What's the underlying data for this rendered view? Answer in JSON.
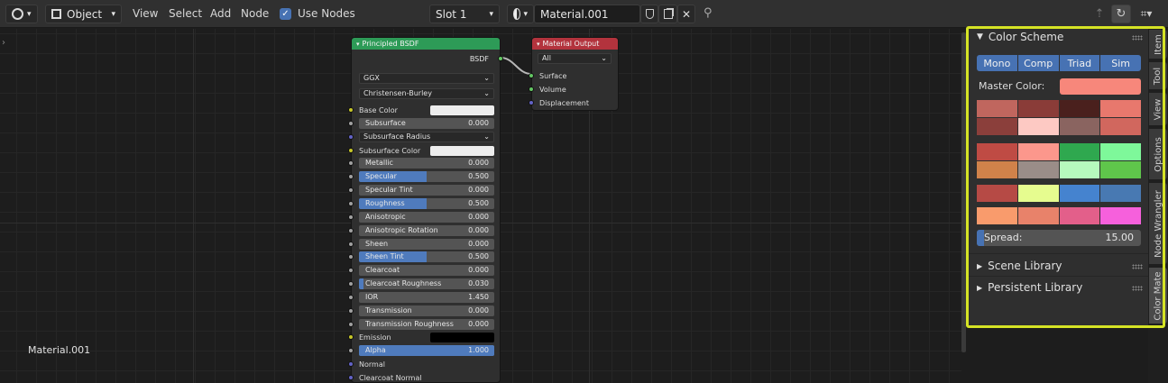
{
  "header": {
    "mode": "Object",
    "menus": [
      "View",
      "Select",
      "Add",
      "Node"
    ],
    "use_nodes_label": "Use Nodes",
    "slot": "Slot 1",
    "material_name": "Material.001"
  },
  "editor": {
    "material_label": "Material.001"
  },
  "principled": {
    "title": "Principled BSDF",
    "output": "BSDF",
    "distribution": "GGX",
    "subsurface_method": "Christensen-Burley",
    "rows": [
      {
        "kind": "color",
        "label": "Base Color",
        "color": "#ededed",
        "socket": "#c7c729"
      },
      {
        "kind": "field",
        "label": "Subsurface",
        "value": "0.000",
        "fill": 0,
        "socket": "#a1a1a1"
      },
      {
        "kind": "select",
        "label": "Subsurface Radius",
        "socket": "#6363c7"
      },
      {
        "kind": "color",
        "label": "Subsurface Color",
        "color": "#ededed",
        "socket": "#c7c729"
      },
      {
        "kind": "field",
        "label": "Metallic",
        "value": "0.000",
        "fill": 0,
        "socket": "#a1a1a1"
      },
      {
        "kind": "field",
        "label": "Specular",
        "value": "0.500",
        "fill": 0.5,
        "socket": "#a1a1a1"
      },
      {
        "kind": "field",
        "label": "Specular Tint",
        "value": "0.000",
        "fill": 0,
        "socket": "#a1a1a1"
      },
      {
        "kind": "field",
        "label": "Roughness",
        "value": "0.500",
        "fill": 0.5,
        "socket": "#a1a1a1"
      },
      {
        "kind": "field",
        "label": "Anisotropic",
        "value": "0.000",
        "fill": 0,
        "socket": "#a1a1a1"
      },
      {
        "kind": "field",
        "label": "Anisotropic Rotation",
        "value": "0.000",
        "fill": 0,
        "socket": "#a1a1a1"
      },
      {
        "kind": "field",
        "label": "Sheen",
        "value": "0.000",
        "fill": 0,
        "socket": "#a1a1a1"
      },
      {
        "kind": "field",
        "label": "Sheen Tint",
        "value": "0.500",
        "fill": 0.5,
        "socket": "#a1a1a1"
      },
      {
        "kind": "field",
        "label": "Clearcoat",
        "value": "0.000",
        "fill": 0,
        "socket": "#a1a1a1"
      },
      {
        "kind": "field",
        "label": "Clearcoat Roughness",
        "value": "0.030",
        "fill": 0.03,
        "socket": "#a1a1a1"
      },
      {
        "kind": "field",
        "label": "IOR",
        "value": "1.450",
        "fill": 0,
        "socket": "#a1a1a1"
      },
      {
        "kind": "field",
        "label": "Transmission",
        "value": "0.000",
        "fill": 0,
        "socket": "#a1a1a1"
      },
      {
        "kind": "field",
        "label": "Transmission Roughness",
        "value": "0.000",
        "fill": 0,
        "socket": "#a1a1a1"
      },
      {
        "kind": "color",
        "label": "Emission",
        "color": "#000000",
        "socket": "#c7c729"
      },
      {
        "kind": "field",
        "label": "Alpha",
        "value": "1.000",
        "fill": 1,
        "socket": "#a1a1a1"
      },
      {
        "kind": "label",
        "label": "Normal",
        "socket": "#6363c7"
      },
      {
        "kind": "label",
        "label": "Clearcoat Normal",
        "socket": "#6363c7"
      }
    ]
  },
  "output_node": {
    "title": "Material Output",
    "target": "All",
    "inputs": [
      {
        "label": "Surface",
        "socket": "#63c763"
      },
      {
        "label": "Volume",
        "socket": "#63c763"
      },
      {
        "label": "Displacement",
        "socket": "#6363c7"
      }
    ]
  },
  "color_scheme": {
    "title": "Color Scheme",
    "modes": [
      "Mono",
      "Comp",
      "Triad",
      "Sim"
    ],
    "master_label": "Master Color:",
    "master_color": "#f7877b",
    "grid1": [
      "#c0665e",
      "#8a3c38",
      "#4a201d",
      "#e8786d",
      "#8b3f3b",
      "#fdc9c3",
      "#8a6460",
      "#d1675e"
    ],
    "grid2": [
      "#bf4b44",
      "#fc978c",
      "#2fa84f",
      "#7ef89a",
      "#d0824a",
      "#9a8d88",
      "#b6f9bd",
      "#5fc64b"
    ],
    "grid3": [
      "#b64a45",
      "#e6fc8f",
      "#4583cf",
      "#4879b2"
    ],
    "grid4": [
      "#f99b6c",
      "#e8826a",
      "#e35f8a",
      "#f660dc"
    ],
    "spread_label": "Spread:",
    "spread_value": "15.00",
    "scene_library": "Scene Library",
    "persistent_library": "Persistent Library"
  },
  "tabs": [
    "Item",
    "Tool",
    "View",
    "Options",
    "Node Wrangler",
    "Color Mate"
  ]
}
